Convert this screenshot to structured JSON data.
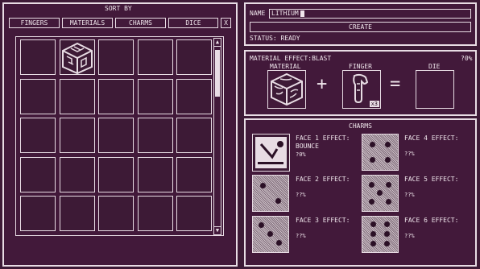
{
  "sort": {
    "title": "SORT BY",
    "tabs": [
      "FINGERS",
      "MATERIALS",
      "CHARMS",
      "DICE"
    ],
    "close": "X"
  },
  "inventory": {
    "scroll_up": "▲",
    "scroll_down": "▼"
  },
  "name_panel": {
    "name_label": "NAME",
    "name_value": "LITHIUM",
    "create_label": "CREATE",
    "status": "STATUS: READY"
  },
  "craft": {
    "effect": "MATERIAL EFFECT:BLAST",
    "percent": "?0%",
    "material_label": "MATERIAL",
    "finger_label": "FINGER",
    "die_label": "DIE",
    "plus": "+",
    "equals": "=",
    "finger_count": "x3"
  },
  "charms": {
    "title": "CHARMS",
    "faces": [
      {
        "label": "FACE 1 EFFECT:",
        "effect": "BOUNCE",
        "value": "?0%"
      },
      {
        "label": "FACE 2 EFFECT:",
        "effect": "",
        "value": "??%"
      },
      {
        "label": "FACE 3 EFFECT:",
        "effect": "",
        "value": "??%"
      },
      {
        "label": "FACE 4 EFFECT:",
        "effect": "",
        "value": "??%"
      },
      {
        "label": "FACE 5 EFFECT:",
        "effect": "",
        "value": "??%"
      },
      {
        "label": "FACE 6 EFFECT:",
        "effect": "",
        "value": "??%"
      }
    ]
  },
  "colors": {
    "background": "#3d1a36",
    "line": "#e8dce4",
    "die_pattern": "#7e6a78"
  }
}
